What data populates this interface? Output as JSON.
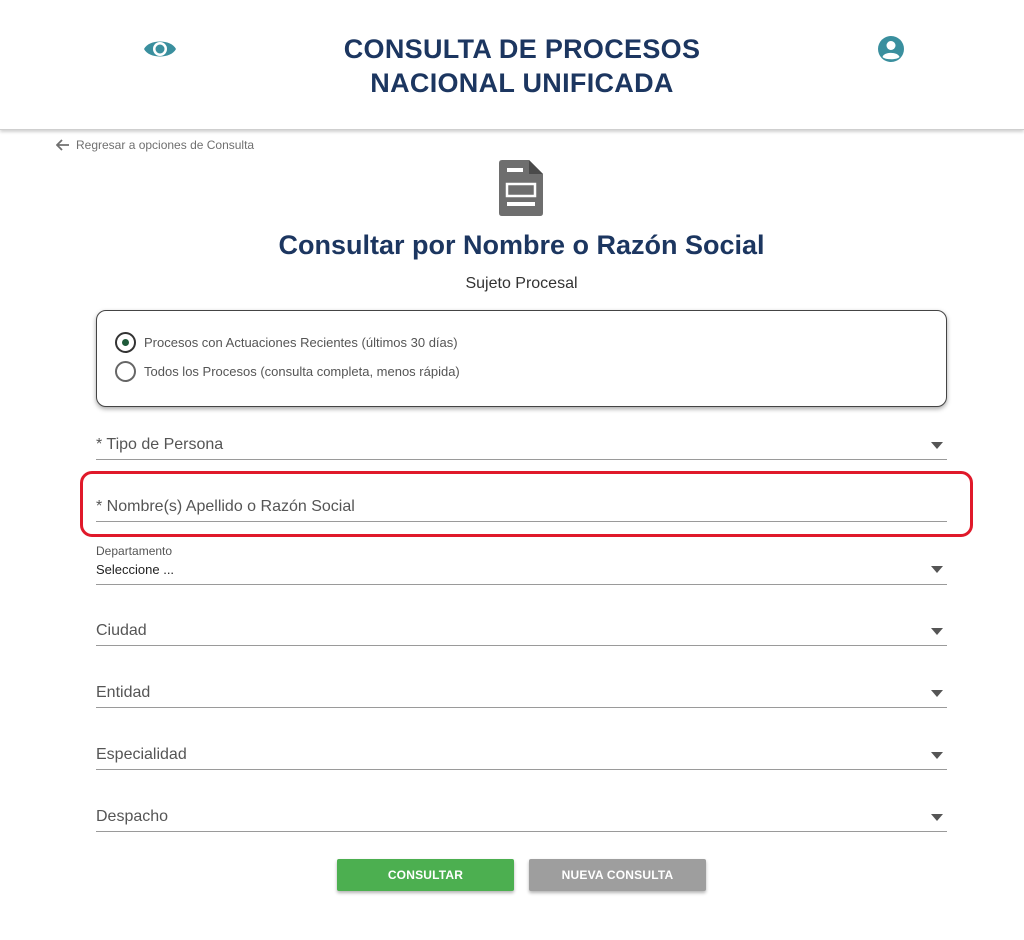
{
  "header": {
    "title_line1": "CONSULTA DE PROCESOS",
    "title_line2": "NACIONAL UNIFICADA",
    "eye_icon": "eye-icon",
    "user_icon": "user-account-icon",
    "accent_color": "#3a8f9e",
    "title_color": "#1c3660"
  },
  "back_link": {
    "label": "Regresar a opciones de Consulta",
    "icon": "arrow-left-icon"
  },
  "page": {
    "icon": "document-icon",
    "title": "Consultar por Nombre o Razón Social",
    "subtitle": "Sujeto Procesal"
  },
  "search_mode": {
    "options": [
      {
        "label": "Procesos con Actuaciones Recientes (últimos 30 días)",
        "selected": true
      },
      {
        "label": "Todos los Procesos (consulta completa, menos rápida)",
        "selected": false
      }
    ]
  },
  "form": {
    "tipo_persona": "* Tipo de Persona",
    "nombre": "* Nombre(s) Apellido o Razón Social",
    "departamento_label": "Departamento",
    "departamento_value": "Seleccione ...",
    "ciudad": "Ciudad",
    "entidad": "Entidad",
    "especialidad": "Especialidad",
    "despacho": "Despacho"
  },
  "buttons": {
    "consultar": "CONSULTAR",
    "nueva_consulta": "NUEVA CONSULTA",
    "consultar_color": "#4caf50",
    "nueva_color": "#9e9e9e"
  },
  "highlight_color": "#e0192a"
}
